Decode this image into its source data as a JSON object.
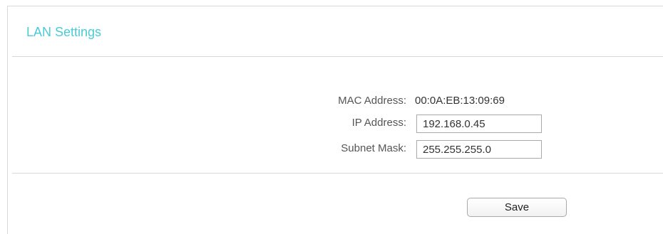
{
  "section": {
    "title": "LAN Settings"
  },
  "form": {
    "mac": {
      "label": "MAC Address:",
      "value": "00:0A:EB:13:09:69"
    },
    "ip": {
      "label": "IP Address:",
      "value": "192.168.0.45"
    },
    "subnet": {
      "label": "Subnet Mask:",
      "value": "255.255.255.0"
    }
  },
  "actions": {
    "save_label": "Save"
  },
  "colors": {
    "title": "#4acbd6",
    "border": "#d8d8d8"
  }
}
